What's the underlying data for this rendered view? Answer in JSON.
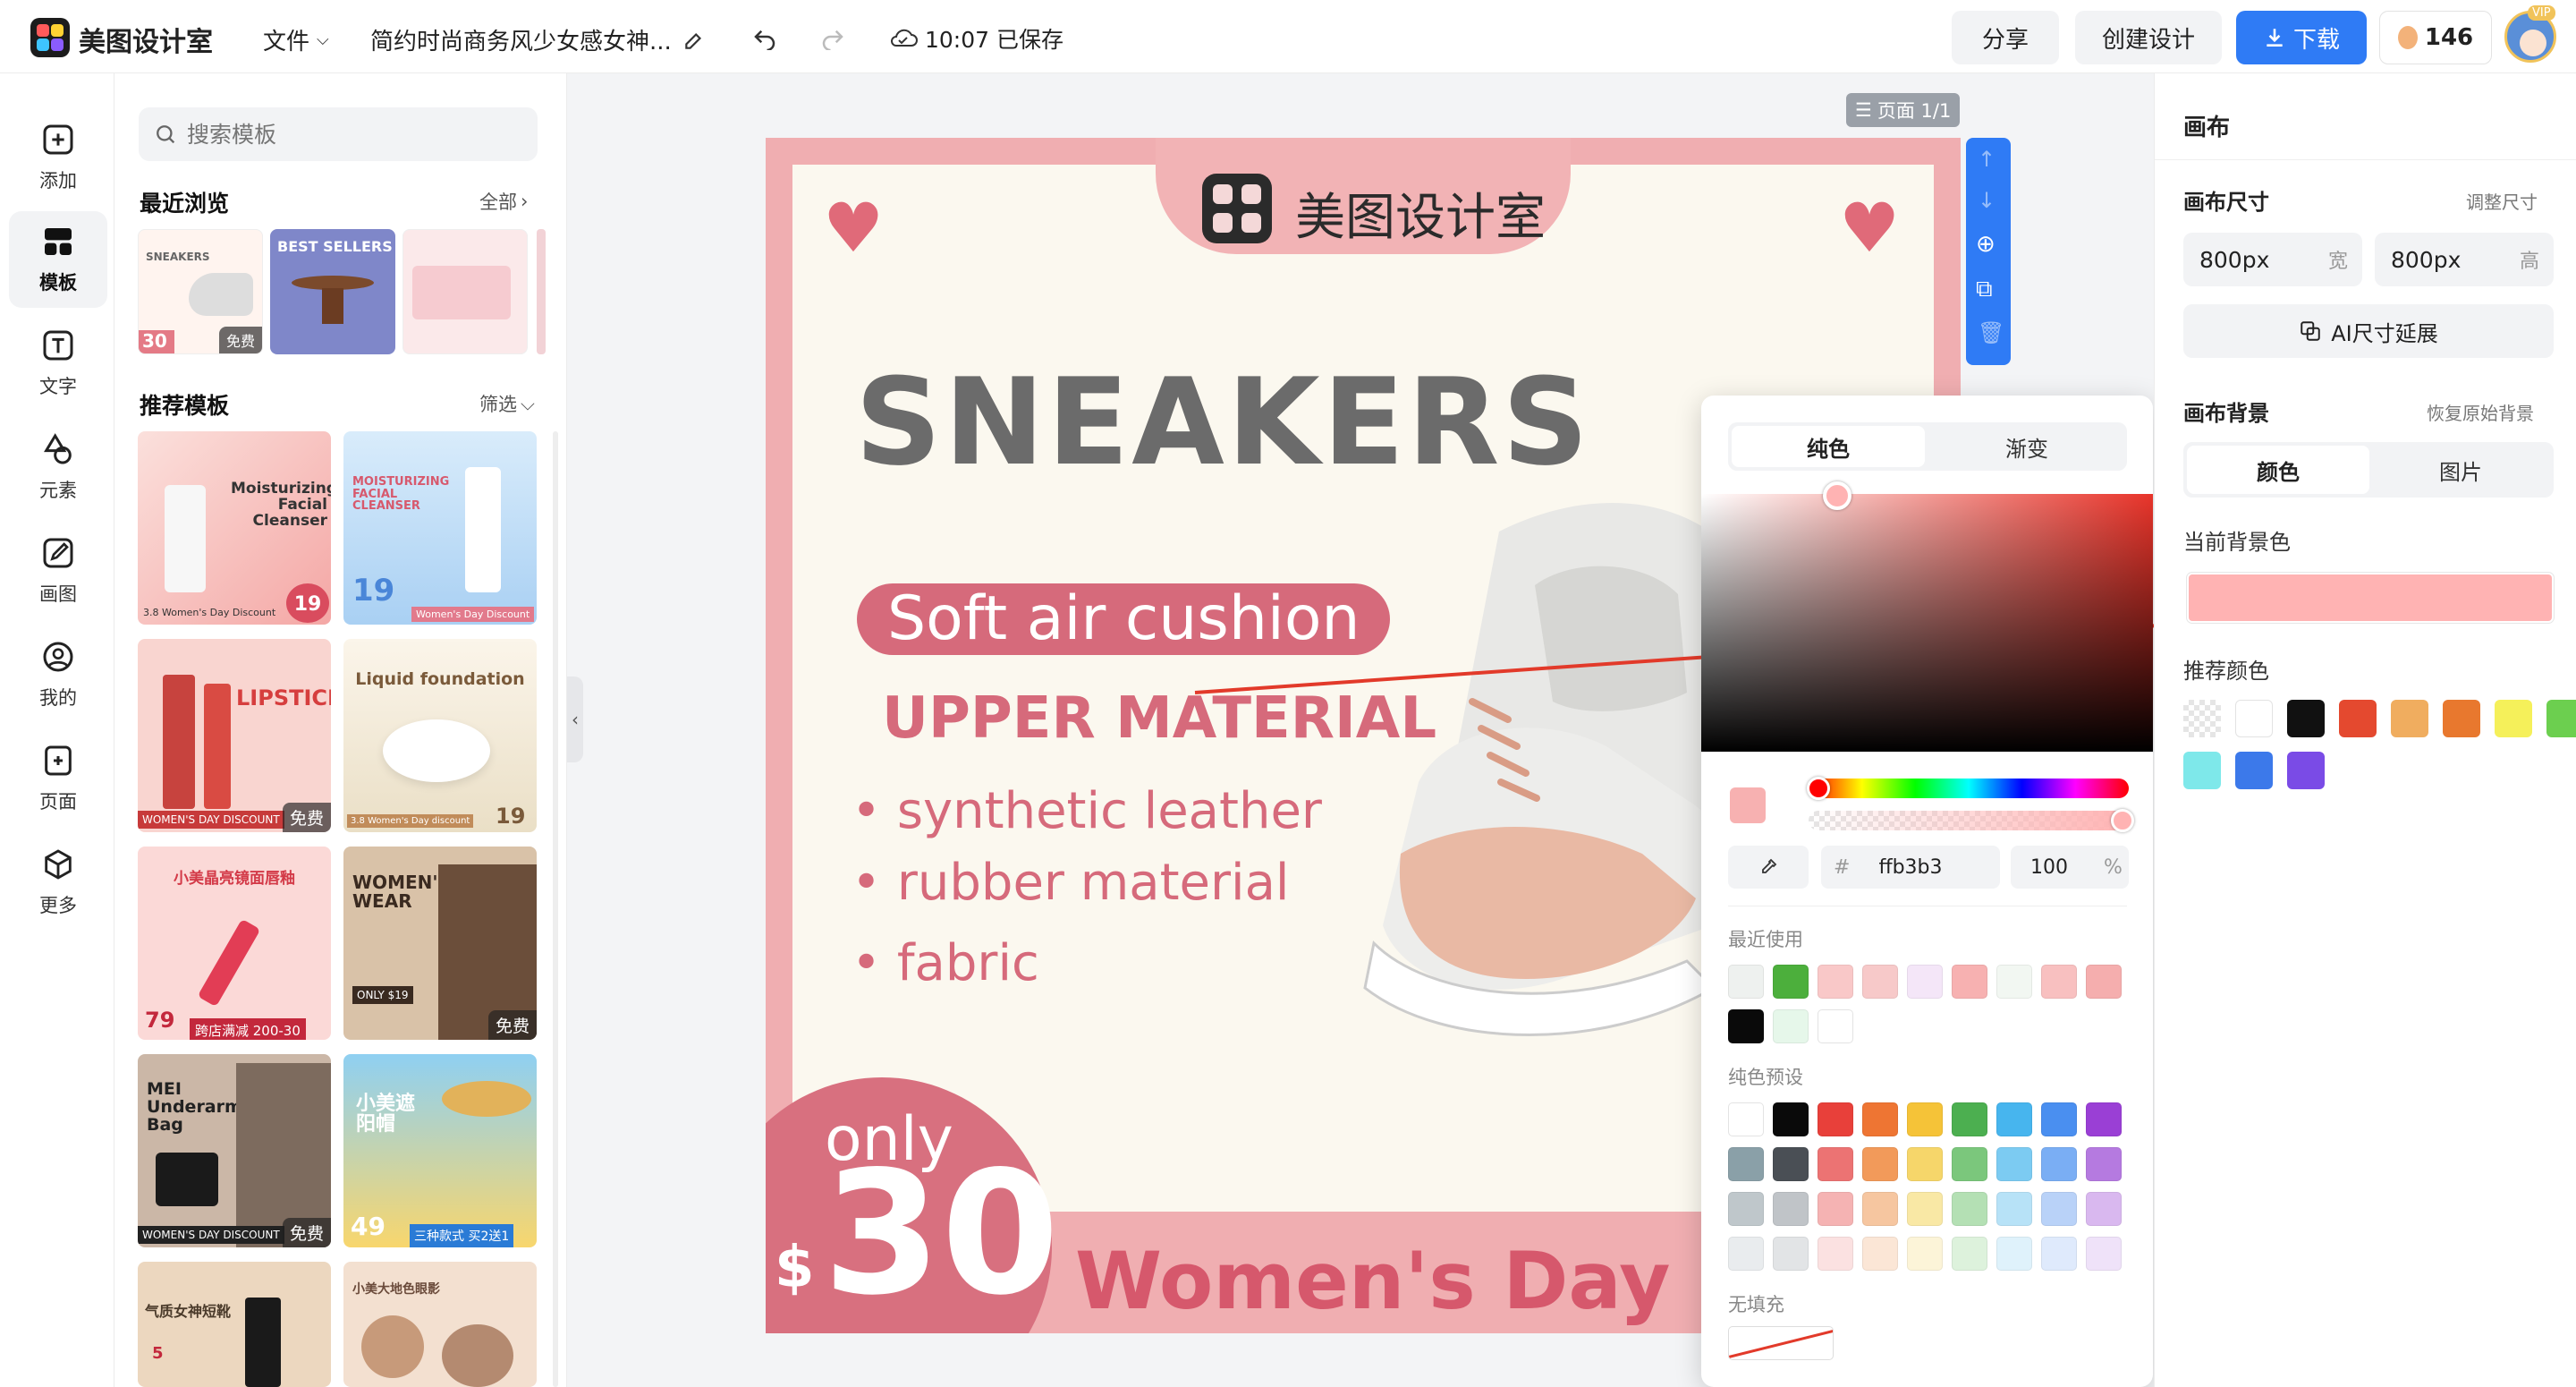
{
  "app": {
    "name": "美图设计室",
    "menu_file": "文件",
    "doc_title": "简约时尚商务风少女感女神...",
    "save_status": "10:07 已保存"
  },
  "topbar": {
    "share": "分享",
    "create": "创建设计",
    "download": "下载",
    "coins": "146",
    "vip_badge": "VIP"
  },
  "rail": [
    {
      "label": "添加",
      "icon": "plus-square-icon"
    },
    {
      "label": "模板",
      "icon": "template-grid-icon"
    },
    {
      "label": "文字",
      "icon": "text-icon"
    },
    {
      "label": "元素",
      "icon": "shapes-icon"
    },
    {
      "label": "画图",
      "icon": "pencil-icon"
    },
    {
      "label": "我的",
      "icon": "user-icon"
    },
    {
      "label": "页面",
      "icon": "page-add-icon"
    },
    {
      "label": "更多",
      "icon": "cube-icon"
    }
  ],
  "panel": {
    "search_placeholder": "搜索模板",
    "recent_title": "最近浏览",
    "recent_link": "全部",
    "recommend_title": "推荐模板",
    "recommend_link": "筛选",
    "recent": [
      {
        "title": "SNEAKERS",
        "badge": "免费",
        "num": "30"
      },
      {
        "title": "BEST SELLERS"
      },
      {
        "title": ""
      }
    ],
    "templates": [
      {
        "title": "Moisturizing Facial Cleanser",
        "price": "19",
        "footer": "3.8 Women's Day Discount"
      },
      {
        "title": "MOISTURIZING FACIAL CLEANSER",
        "price": "19",
        "footer": "Women's Day Discount"
      },
      {
        "title": "LIPSTICK",
        "footer": "WOMEN'S DAY DISCOUNT",
        "badge": "免费"
      },
      {
        "title": "Liquid foundation",
        "price": "19",
        "footer": "3.8 Women's Day discount"
      },
      {
        "title": "小美晶亮镜面唇釉",
        "price": "79",
        "footer": "跨店满减 200-30"
      },
      {
        "title": "WOMEN'S WEAR",
        "price": "ONLY $19",
        "badge": "免费"
      },
      {
        "title": "MEI Underarm Bag",
        "footer": "WOMEN'S DAY DISCOUNT",
        "badge": "免费"
      },
      {
        "title": "小美遮阳帽",
        "price": "49",
        "footer": "三种款式 买2送1"
      },
      {
        "title": "气质女神短靴",
        "price": "5"
      },
      {
        "title": "小美大地色眼影"
      }
    ]
  },
  "canvas": {
    "page_indicator": "页面 1/1",
    "brand": "美图设计室",
    "headline": "SNEAKERS",
    "pill": "Soft air cushion",
    "subhead": "UPPER MATERIAL",
    "bullets": [
      "synthetic leather",
      "rubber material",
      "fabric"
    ],
    "only": "only",
    "dollar": "$",
    "price": "30",
    "banner": "Women's Day Dis",
    "bg_color": "#ffb3b3"
  },
  "right": {
    "title": "画布",
    "size_title": "画布尺寸",
    "size_adjust": "调整尺寸",
    "width_value": "800px",
    "width_unit": "宽",
    "height_value": "800px",
    "height_unit": "高",
    "ai_extend": "AI尺寸延展",
    "bg_title": "画布背景",
    "bg_restore": "恢复原始背景",
    "tab_color": "颜色",
    "tab_image": "图片",
    "current_bg": "当前背景色",
    "recommend_colors_title": "推荐颜色",
    "recommend_colors": [
      "transparent",
      "#ffffff",
      "#111111",
      "#e4492f",
      "#f0ad5f",
      "#e8782e",
      "#f5f05a",
      "#6ccf4f",
      "#7ee8ea",
      "#3c79ea",
      "#7a4be6"
    ]
  },
  "picker": {
    "tab_solid": "纯色",
    "tab_gradient": "渐变",
    "hex_prefix": "#",
    "hex": "ffb3b3",
    "opacity": "100",
    "opacity_unit": "%",
    "recent_title": "最近使用",
    "recent_colors": [
      "#eef1ef",
      "#4caf3c",
      "#f9c8c8",
      "#f7c9c9",
      "#f4e6f8",
      "#f7b1b1",
      "#f2f7f2",
      "#f8c0c0",
      "#f5aeae",
      "#0a0a0a",
      "#e6f7ea",
      "#ffffff"
    ],
    "preset_title": "纯色预设",
    "preset_colors": [
      "#ffffff",
      "#0a0a0a",
      "#e8403a",
      "#ee7533",
      "#f5c338",
      "#4caf50",
      "#47b5ee",
      "#4a8ff0",
      "#9a3fd5",
      "#8aa0a8",
      "#4a4f55",
      "#ec7373",
      "#f29a5a",
      "#f6d66a",
      "#7bc77c",
      "#7ccbf2",
      "#7aaef4",
      "#b57ae0",
      "#bfc7cb",
      "#c0c4c8",
      "#f5b3b3",
      "#f6c6a0",
      "#f9e8a5",
      "#b4e0b4",
      "#b7e2f7",
      "#b9d2f8",
      "#d9b8ef",
      "#e9ecee",
      "#e2e4e6",
      "#fbe1e1",
      "#fbe6d6",
      "#fcf4d8",
      "#ddf2dc",
      "#dff2fb",
      "#dfeafc",
      "#efe2f9"
    ],
    "no_fill_title": "无填充"
  }
}
